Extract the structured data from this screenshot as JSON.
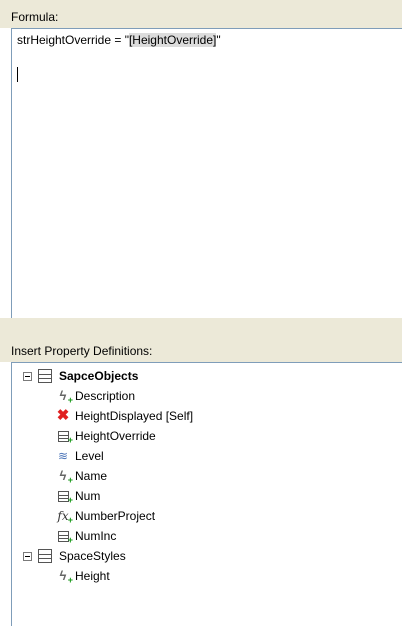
{
  "formula": {
    "label": "Formula:",
    "text_prefix": "strHeightOverride = \"",
    "text_highlight": "[HeightOverride]",
    "text_suffix": "\""
  },
  "insert": {
    "label": "Insert Property Definitions:"
  },
  "tree": {
    "groups": [
      {
        "name": "SapceObjects",
        "bold": true,
        "items": [
          {
            "label": "Description",
            "icon": "automatic-property-icon"
          },
          {
            "label": "HeightDisplayed [Self]",
            "icon": "error-x-icon"
          },
          {
            "label": "HeightOverride",
            "icon": "manual-property-icon"
          },
          {
            "label": "Level",
            "icon": "level-icon"
          },
          {
            "label": "Name",
            "icon": "automatic-property-icon"
          },
          {
            "label": "Num",
            "icon": "manual-property-icon"
          },
          {
            "label": "NumberProject",
            "icon": "formula-property-icon"
          },
          {
            "label": "NumInc",
            "icon": "manual-property-icon"
          }
        ]
      },
      {
        "name": "SpaceStyles",
        "bold": false,
        "items": [
          {
            "label": "Height",
            "icon": "automatic-property-icon"
          }
        ]
      }
    ]
  }
}
